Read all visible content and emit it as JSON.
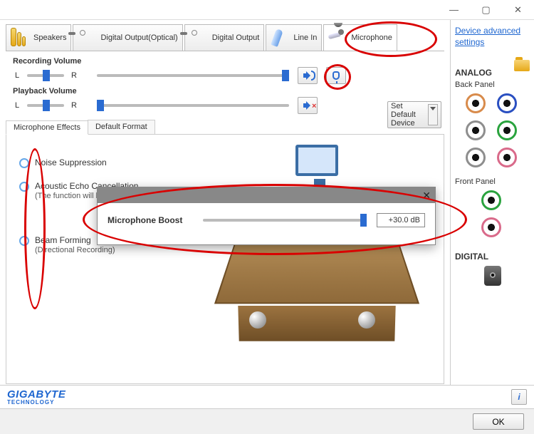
{
  "window": {
    "title": ""
  },
  "tabs": {
    "speakers": "Speakers",
    "digital_optical": "Digital Output(Optical)",
    "digital": "Digital Output",
    "linein": "Line In",
    "microphone": "Microphone"
  },
  "sidebar_link": "Device advanced settings",
  "sliders": {
    "rec_label": "Recording Volume",
    "play_label": "Playback Volume",
    "L": "L",
    "R": "R"
  },
  "default_btn": "Set Default Device",
  "subtabs": {
    "fx": "Microphone Effects",
    "fmt": "Default Format"
  },
  "effects": {
    "noise": {
      "label": "Noise Suppression"
    },
    "echo": {
      "label": "Acoustic Echo Cancellation",
      "note": "(The function will become valid starting from the next recording.)"
    },
    "beam": {
      "label": "Beam Forming",
      "note": "(Directional Recording)"
    }
  },
  "right": {
    "analog": "ANALOG",
    "back": "Back Panel",
    "front": "Front Panel",
    "digital": "DIGITAL"
  },
  "brand": {
    "name": "GIGABYTE",
    "sub": "TECHNOLOGY"
  },
  "ok": "OK",
  "info": "i",
  "dialog": {
    "label": "Microphone Boost",
    "value": "+30.0 dB"
  }
}
